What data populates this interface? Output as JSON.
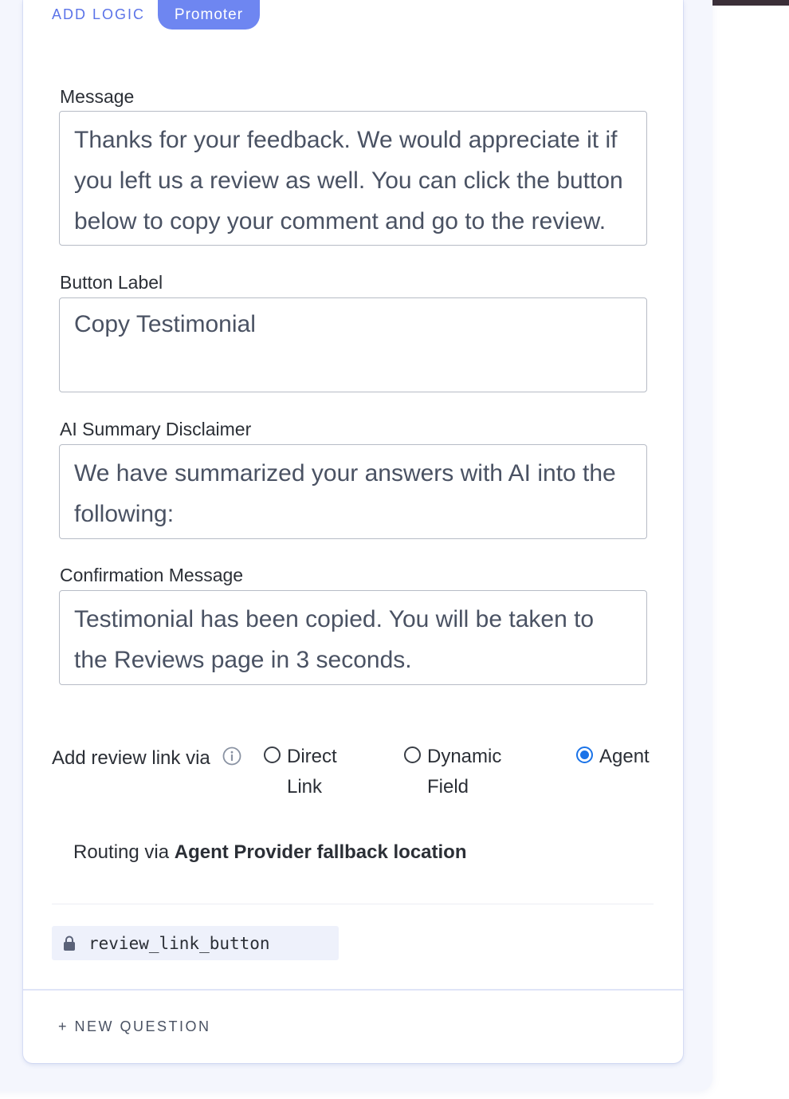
{
  "header": {
    "add_logic_label": "ADD LOGIC",
    "segment_badge": "Promoter"
  },
  "fields": {
    "message": {
      "label": "Message",
      "value": "Thanks for your feedback. We would appreciate it if you left us a review as well. You can click the button below to copy your comment and go to the review."
    },
    "button_label": {
      "label": "Button Label",
      "value": "Copy Testimonial"
    },
    "ai_disclaimer": {
      "label": "AI Summary Disclaimer",
      "value": "We have summarized your answers with AI into the following:"
    },
    "confirmation": {
      "label": "Confirmation Message",
      "value": "Testimonial has been copied. You will be taken to the Reviews page in 3 seconds."
    }
  },
  "review_link": {
    "label": "Add review link via",
    "options": [
      {
        "label": "Direct Link",
        "selected": false
      },
      {
        "label": "Dynamic Field",
        "selected": false
      },
      {
        "label": "Agent",
        "selected": true
      }
    ],
    "selected_color": "#1a73e8"
  },
  "routing": {
    "prefix": "Routing via",
    "target": "Agent Provider fallback location"
  },
  "question_key": {
    "icon": "lock-icon",
    "value": "review_link_button"
  },
  "footer": {
    "new_question_label": "+ NEW QUESTION"
  },
  "colors": {
    "accent": "#5b73e8",
    "badge_bg": "#6e86f1"
  }
}
